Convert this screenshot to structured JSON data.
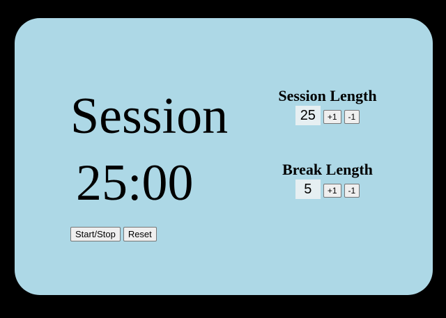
{
  "timer": {
    "label": "Session",
    "time": "25:00"
  },
  "controls": {
    "start_stop_label": "Start/Stop",
    "reset_label": "Reset"
  },
  "session_setting": {
    "title": "Session Length",
    "value": "25",
    "increment_label": "+1",
    "decrement_label": "-1"
  },
  "break_setting": {
    "title": "Break Length",
    "value": "5",
    "increment_label": "+1",
    "decrement_label": "-1"
  },
  "colors": {
    "background": "#000000",
    "card": "#add8e6",
    "value_box": "#e6eff2"
  }
}
